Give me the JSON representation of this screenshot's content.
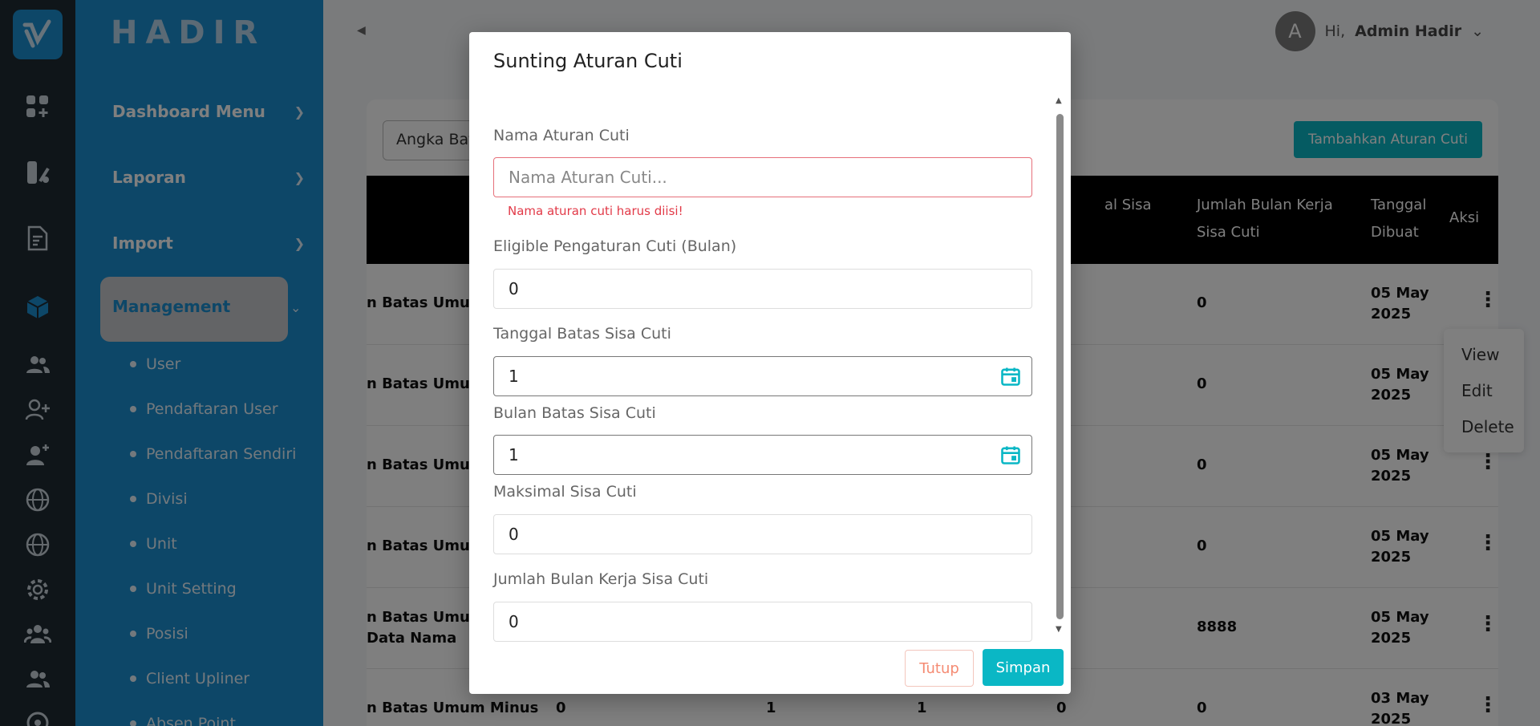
{
  "app": {
    "brand": "HADIR"
  },
  "sidebar": {
    "menus": [
      {
        "label": "Dashboard Menu"
      },
      {
        "label": "Laporan"
      },
      {
        "label": "Import"
      }
    ],
    "active_menu": "Management",
    "submenu": [
      {
        "label": "User"
      },
      {
        "label": "Pendaftaran User"
      },
      {
        "label": "Pendaftaran Sendiri"
      },
      {
        "label": "Divisi"
      },
      {
        "label": "Unit"
      },
      {
        "label": "Unit Setting"
      },
      {
        "label": "Posisi"
      },
      {
        "label": "Client Upliner"
      },
      {
        "label": "Absen Point"
      }
    ]
  },
  "header": {
    "avatar_initial": "A",
    "greeting": "Hi,",
    "username": "Admin Hadir"
  },
  "page": {
    "filter_value": "Angka Batas",
    "add_button": "Tambahkan Aturan Cuti",
    "table": {
      "headers": {
        "maks_partial": "al Sisa",
        "jumlah_bulan": "Jumlah Bulan Kerja Sisa Cuti",
        "tanggal": "Tanggal Dibuat",
        "aksi": "Aksi"
      },
      "rows": [
        {
          "name": "n Batas Umum M",
          "jumlah": "0",
          "date": "05 May 2025"
        },
        {
          "name": "n Batas Umum M",
          "jumlah": "0",
          "date": "05 May 2025"
        },
        {
          "name": "n Batas Umum M",
          "jumlah": "0",
          "date": "05 May 2025"
        },
        {
          "name": "n Batas Umum M",
          "jumlah": "0",
          "date": "05 May 2025"
        },
        {
          "name": "n Batas UmumT\nData Nama",
          "jumlah": "8888",
          "date": "05 May 2025"
        },
        {
          "name": "n Batas Umum Minus",
          "col1": "0",
          "col2": "1",
          "col3": "1",
          "col4": "0",
          "jumlah": "0",
          "date": "03 May 2025"
        }
      ]
    },
    "context_menu": [
      "View",
      "Edit",
      "Delete"
    ]
  },
  "modal": {
    "title": "Sunting Aturan Cuti",
    "fields": {
      "nama": {
        "label": "Nama Aturan Cuti",
        "placeholder": "Nama Aturan Cuti...",
        "error": "Nama aturan cuti harus diisi!"
      },
      "eligible": {
        "label": "Eligible Pengaturan Cuti (Bulan)",
        "value": "0"
      },
      "tanggal_batas": {
        "label": "Tanggal Batas Sisa Cuti",
        "value": "1"
      },
      "bulan_batas": {
        "label": "Bulan Batas Sisa Cuti",
        "value": "1"
      },
      "maksimal": {
        "label": "Maksimal Sisa Cuti",
        "value": "0"
      },
      "jumlah_bulan": {
        "label": "Jumlah Bulan Kerja Sisa Cuti",
        "value": "0"
      }
    },
    "buttons": {
      "close": "Tutup",
      "save": "Simpan"
    }
  },
  "colors": {
    "sidebar": "#1a8fd1",
    "rail": "#1e2a33",
    "accent": "#0ab7c5",
    "error": "#e23a48"
  }
}
